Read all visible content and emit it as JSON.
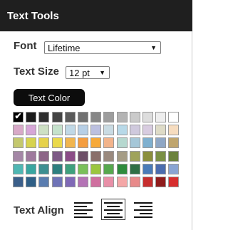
{
  "panel": {
    "title": "Text Tools"
  },
  "font": {
    "label": "Font",
    "selected": "Lifetime",
    "arrow": "▼"
  },
  "text_size": {
    "label": "Text Size",
    "selected": "12 pt",
    "arrow": "▼"
  },
  "text_color": {
    "button_label": "Text Color",
    "check_glyph": "✔",
    "selected_color": "#000000",
    "palette_rows": [
      [
        "#000000",
        "#1a1a1a",
        "#2f2f2f",
        "#444444",
        "#5a5a5a",
        "#707070",
        "#878787",
        "#9d9d9d",
        "#b4b4b4",
        "#cacaca",
        "#dddddd",
        "#eeeeee",
        "#ffffff"
      ],
      [
        "#d8a9c8",
        "#d6a6d7",
        "#cde0c4",
        "#c5e2cc",
        "#c0d8e6",
        "#b7cfe6",
        "#bcc0e0",
        "#c9dbe3",
        "#b8d9e8",
        "#cfc9dd",
        "#d8cce0",
        "#dedbc7",
        "#f6dcbf"
      ],
      [
        "#c4c86e",
        "#d7d34f",
        "#e6d24a",
        "#ead94b",
        "#f1b54e",
        "#f49d3f",
        "#f6a93a",
        "#f2b48b",
        "#b6d8cf",
        "#a5c7d8",
        "#7fb0cf",
        "#8fa7c5",
        "#bfa56d"
      ],
      [
        "#a487a6",
        "#9e7a9d",
        "#8c6587",
        "#7d5a86",
        "#8b4d87",
        "#6d4f67",
        "#8a6f6a",
        "#9a8a7e",
        "#a59c85",
        "#9fa35a",
        "#8b8f3d",
        "#7a9045",
        "#6b823d"
      ],
      [
        "#4fb7b3",
        "#39a6a0",
        "#3d8f91",
        "#2d7f7f",
        "#3ea07d",
        "#7ac05a",
        "#9bc63f",
        "#56a84e",
        "#2e8c3d",
        "#2e6f45",
        "#4a7bb8",
        "#4b6cae",
        "#8aa4d3"
      ],
      [
        "#3b5f8a",
        "#2f5f86",
        "#5a7db0",
        "#6f73b7",
        "#7f69b6",
        "#b473b5",
        "#cf6f9f",
        "#e88fa7",
        "#f4a7a7",
        "#e88a8a",
        "#c62e2e",
        "#8f1c1c",
        "#d72e2e"
      ]
    ]
  },
  "text_align": {
    "label": "Text Align",
    "options": [
      {
        "name": "left",
        "selected": false
      },
      {
        "name": "center",
        "selected": true
      },
      {
        "name": "right",
        "selected": false
      }
    ]
  },
  "colors": {
    "header_bg": "#1f1f1f",
    "button_bg": "#0c0c0c",
    "label_text": "#333333"
  }
}
